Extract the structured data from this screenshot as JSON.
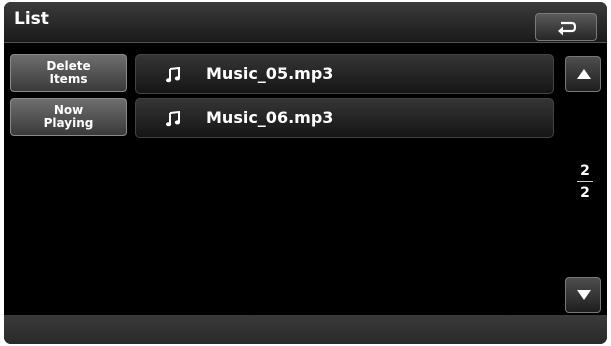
{
  "header": {
    "title": "List",
    "back_icon": "back-arrow-icon"
  },
  "sidebar": {
    "buttons": [
      {
        "label": "Delete\nItems"
      },
      {
        "label": "Now\nPlaying"
      }
    ]
  },
  "list": {
    "items": [
      {
        "icon": "music-note-icon",
        "label": "Music_05.mp3"
      },
      {
        "icon": "music-note-icon",
        "label": "Music_06.mp3"
      }
    ]
  },
  "pagination": {
    "current": "2",
    "total": "2",
    "up_icon": "triangle-up-icon",
    "down_icon": "triangle-down-icon"
  },
  "colors": {
    "background": "#000000",
    "header": "#2a2a2a",
    "button": "#555555",
    "text": "#ffffff"
  }
}
